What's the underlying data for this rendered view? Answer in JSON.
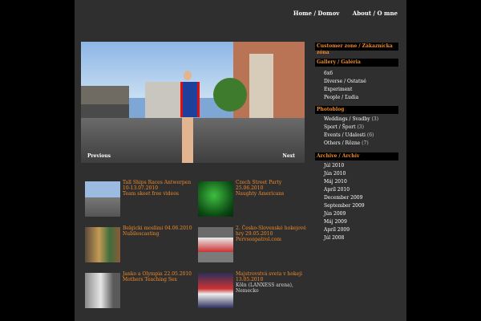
{
  "nav": {
    "home": "Home / Domov",
    "about": "About / O mne"
  },
  "hero": {
    "previous": "Previous",
    "next": "Next"
  },
  "posts": [
    {
      "title": "Tall Ships Races Antwerpen 10-13.07.2010",
      "subtitle": "Team skeet free videos",
      "extra": ""
    },
    {
      "title": "Czech Street Party 25.06.2010",
      "subtitle": "Naughty Americans",
      "extra": ""
    },
    {
      "title": "Belgicki moslimi 04.06.2010",
      "subtitle": "Nubilescasting",
      "extra": ""
    },
    {
      "title": "2. Česko-Slovenské hokejové hry 29.05.2010",
      "subtitle": "Pervsonpatrol.com",
      "extra": ""
    },
    {
      "title": "Janko a Olympia 22.05.2010",
      "subtitle": "Mothers Teaching Sex",
      "extra": ""
    },
    {
      "title": "Majstrovstvá sveta v hokeji 13.05.2010",
      "subtitle": "",
      "extra": "Köln (LANXESS arena), Nemecko"
    }
  ],
  "sidebar": {
    "customer": "Customer zone / Zákaznícka zóna",
    "gallery_title": "Gallery / Galéria",
    "gallery": [
      "6x6",
      "Diverse / Ostatné",
      "Experiment",
      "People / Ľudia"
    ],
    "photoblog_title": "Photoblog",
    "photoblog": [
      {
        "label": "Weddings / Svadby",
        "count": "(3)"
      },
      {
        "label": "Sport / Šport",
        "count": "(3)"
      },
      {
        "label": "Events / Udalosti",
        "count": "(6)"
      },
      {
        "label": "Others / Rôzne",
        "count": "(7)"
      }
    ],
    "archive_title": "Archive / Archív",
    "archive": [
      "Júl 2010",
      "Jún 2010",
      "Máj 2010",
      "Apríl 2010",
      "December 2009",
      "September 2009",
      "Jún 2009",
      "Máj 2009",
      "Apríl 2009",
      "Júl 2008"
    ]
  },
  "colors": {
    "background": "#000000",
    "panel": "#2f2f2f",
    "accent": "#f08a2a"
  }
}
